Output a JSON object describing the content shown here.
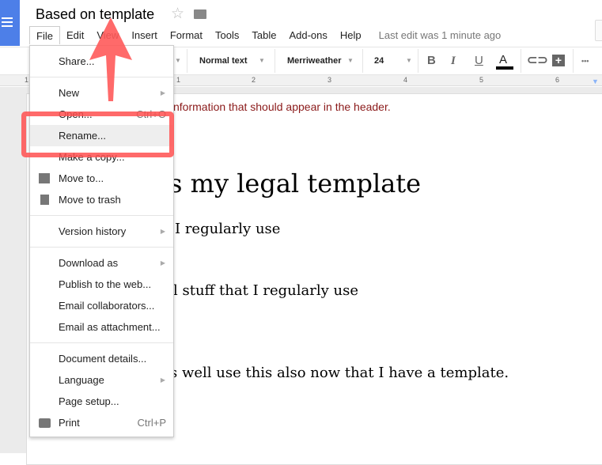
{
  "app": {
    "title": "Based on template",
    "last_edit": "Last edit was 1 minute ago"
  },
  "menubar": [
    "File",
    "Edit",
    "View",
    "Insert",
    "Format",
    "Tools",
    "Table",
    "Add-ons",
    "Help"
  ],
  "toolbar": {
    "style": "Normal text",
    "font": "Merriweather",
    "size": "24",
    "bold": "B",
    "italic": "I",
    "underline": "U",
    "text_color": "A",
    "more": "•••",
    "text_color_value": "#000000"
  },
  "ruler": [
    "1",
    "1",
    "2",
    "3",
    "4",
    "5",
    "6"
  ],
  "document": {
    "header_line": "nformation that should appear in the header.",
    "heading": "s my legal template",
    "line1": "I regularly use",
    "line2": "l stuff that I regularly use",
    "line3": "s well use this also now that I have a template."
  },
  "file_menu": {
    "share": "Share...",
    "new": "New",
    "open": "Open...",
    "open_shortcut": "Ctrl+O",
    "rename": "Rename...",
    "make_copy": "Make a copy...",
    "move_to": "Move to...",
    "move_trash": "Move to trash",
    "version_history": "Version history",
    "download_as": "Download as",
    "publish": "Publish to the web...",
    "email_collab": "Email collaborators...",
    "email_attach": "Email as attachment...",
    "doc_details": "Document details...",
    "language": "Language",
    "page_setup": "Page setup...",
    "print": "Print",
    "print_shortcut": "Ctrl+P"
  },
  "colors": {
    "brand": "#4d7fe8",
    "annotation": "#ff5050",
    "header_text": "#8b1a1a"
  }
}
